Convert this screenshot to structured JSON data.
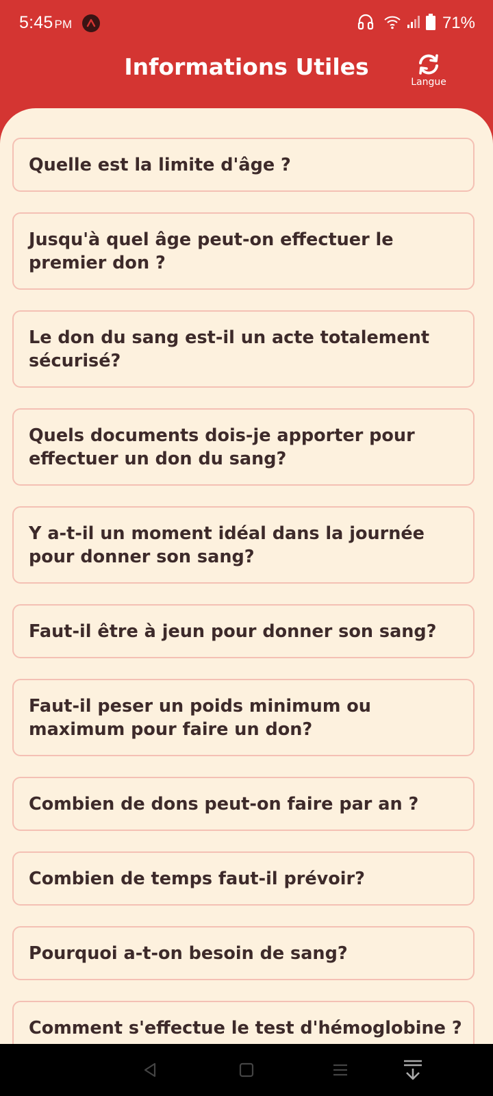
{
  "status_bar": {
    "time": "5:45",
    "ampm": "PM",
    "battery": "71%",
    "icons": [
      "app-badge-icon",
      "headphones-icon",
      "wifi-icon",
      "signal-icon",
      "battery-icon"
    ]
  },
  "header": {
    "title": "Informations Utiles",
    "language_button_label": "Langue",
    "language_icon": "refresh-icon"
  },
  "faq": {
    "items": [
      {
        "label": "Quelle est la limite d'âge ?"
      },
      {
        "label": "Jusqu'à quel âge peut-on effectuer le premier don ?"
      },
      {
        "label": "Le don du sang est-il un acte totalement sécurisé?"
      },
      {
        "label": "Quels documents dois-je apporter pour effectuer un don du sang?"
      },
      {
        "label": "Y a-t-il un moment idéal dans la journée pour donner son sang?"
      },
      {
        "label": "Faut-il être à jeun pour donner son sang?"
      },
      {
        "label": "Faut-il peser un poids minimum ou maximum pour faire un don?"
      },
      {
        "label": "Combien de dons peut-on faire par an ?"
      },
      {
        "label": "Combien de temps faut-il prévoir?"
      },
      {
        "label": "Pourquoi a-t-on besoin de sang?"
      },
      {
        "label": "Comment s'effectue le test d'hémoglobine ?"
      }
    ]
  },
  "nav_bar": {
    "icons": [
      "back-icon",
      "home-icon",
      "recents-icon",
      "expand-down-icon"
    ]
  },
  "colors": {
    "brand_red": "#d43532",
    "panel_background": "#fdf1de",
    "card_border": "#f4c0b4",
    "card_text": "#3d2a2a"
  }
}
